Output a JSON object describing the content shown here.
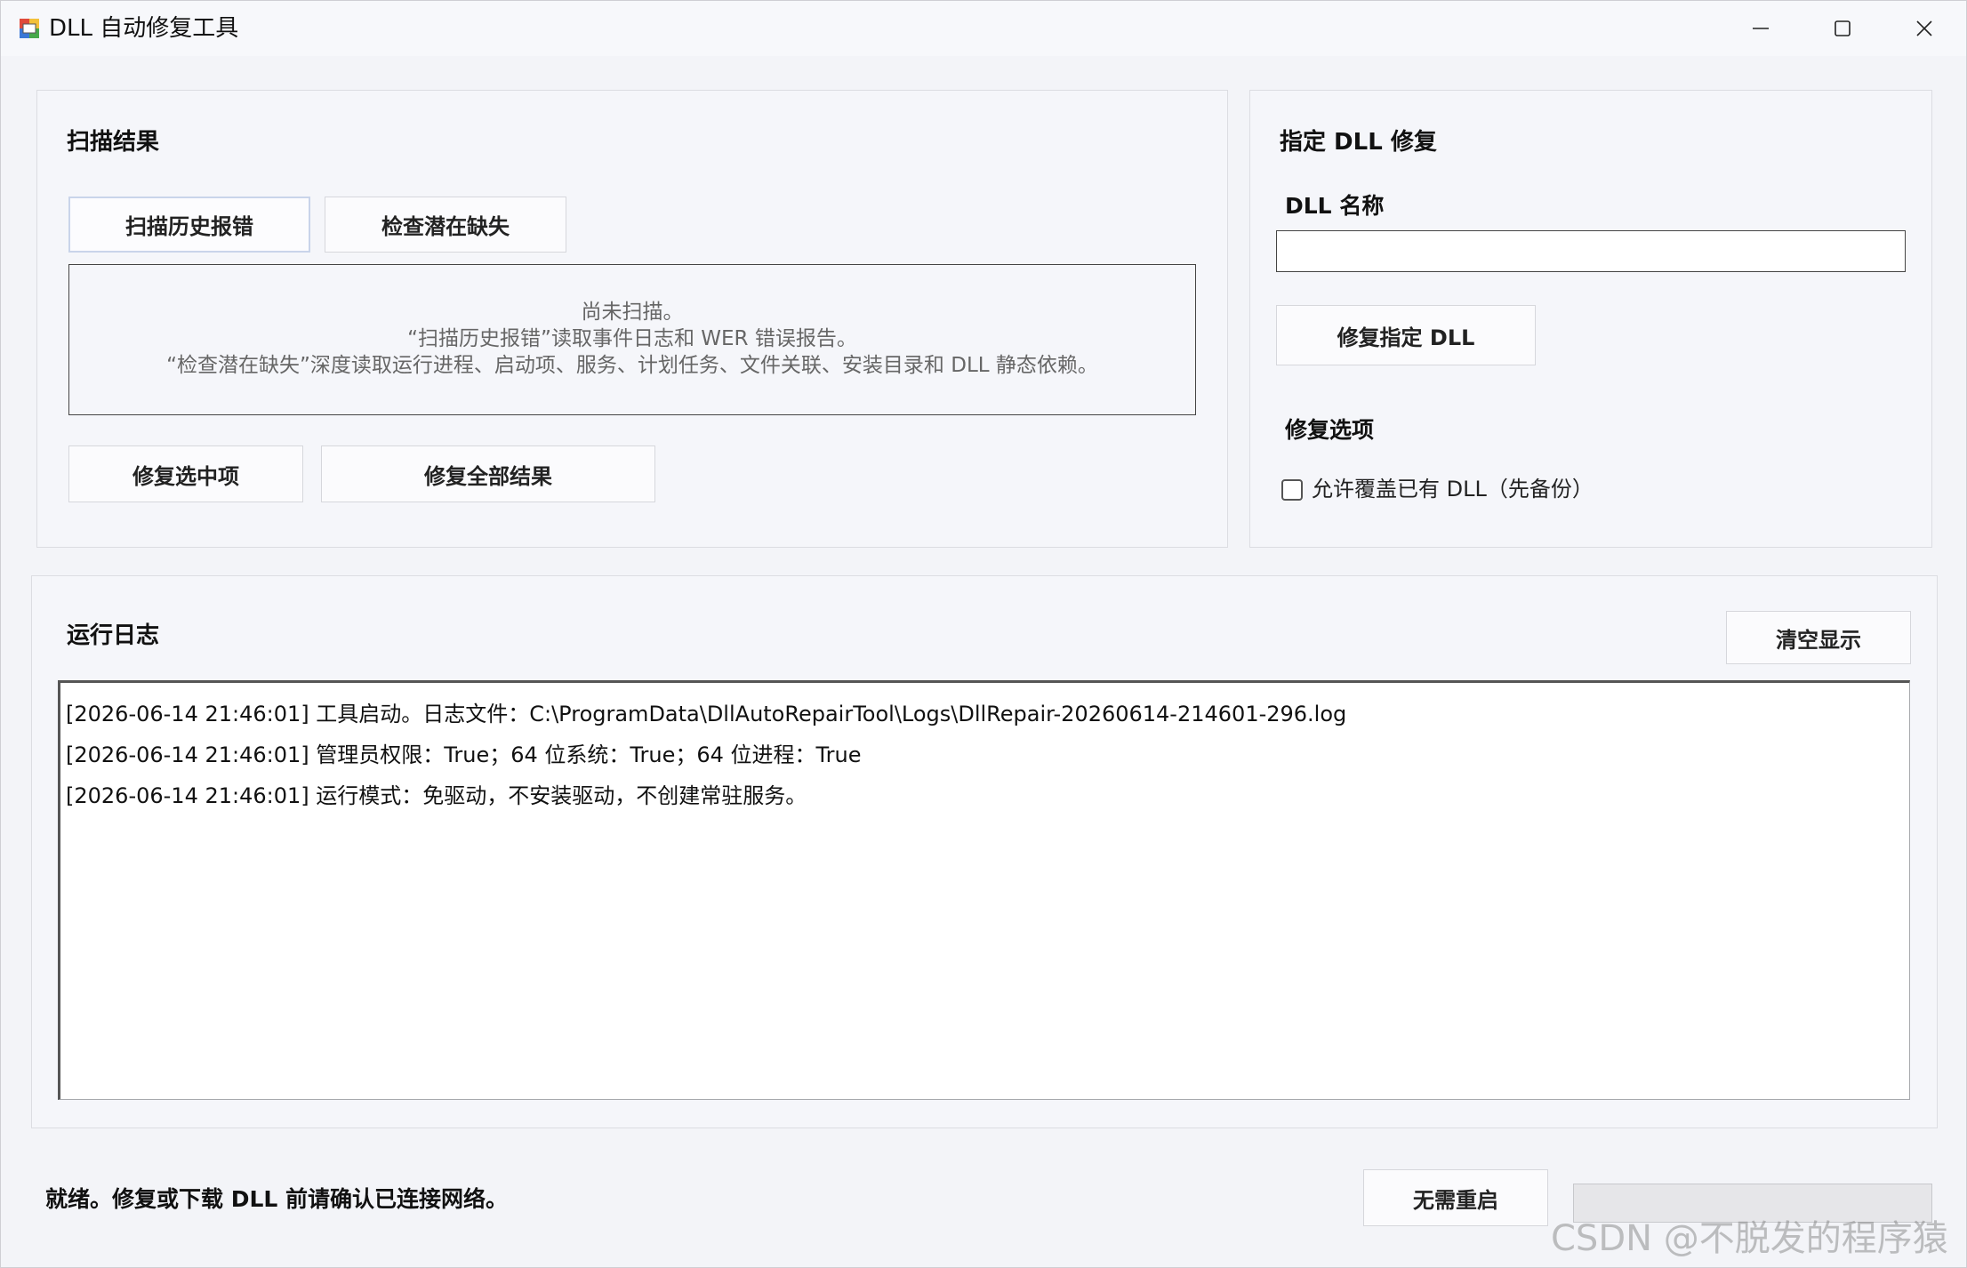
{
  "window": {
    "title": "DLL 自动修复工具",
    "controls": [
      "minimize-icon",
      "maximize-icon",
      "close-icon"
    ]
  },
  "scan": {
    "heading": "扫描结果",
    "scan_history_button": "扫描历史报错",
    "check_missing_button": "检查潜在缺失",
    "info_lines": [
      "尚未扫描。",
      "“扫描历史报错”读取事件日志和 WER 错误报告。",
      "“检查潜在缺失”深度读取运行进程、启动项、服务、计划任务、文件关联、安装目录和 DLL 静态依赖。"
    ],
    "repair_selected_button": "修复选中项",
    "repair_all_button": "修复全部结果"
  },
  "specific": {
    "heading": "指定 DLL 修复",
    "name_label": "DLL 名称",
    "name_value": "",
    "repair_button": "修复指定 DLL",
    "options_heading": "修复选项",
    "overwrite_label": "允许覆盖已有 DLL（先备份）",
    "overwrite_checked": false
  },
  "log": {
    "heading": "运行日志",
    "clear_button": "清空显示",
    "lines": [
      "[2026-06-14 21:46:01] 工具启动。日志文件：C:\\ProgramData\\DllAutoRepairTool\\Logs\\DllRepair-20260614-214601-296.log",
      "[2026-06-14 21:46:01] 管理员权限：True；64 位系统：True；64 位进程：True",
      "[2026-06-14 21:46:01] 运行模式：免驱动，不安装驱动，不创建常驻服务。"
    ]
  },
  "footer": {
    "status": "就绪。修复或下载 DLL 前请确认已连接网络。",
    "restart_button": "无需重启",
    "progress": 0
  },
  "watermark": "CSDN @不脱发的程序猿",
  "colors": {
    "background": "#f3f4f8",
    "panel": "#f5f6fa",
    "border": "#dcdde2",
    "focus_border": "#c9d4ea"
  }
}
